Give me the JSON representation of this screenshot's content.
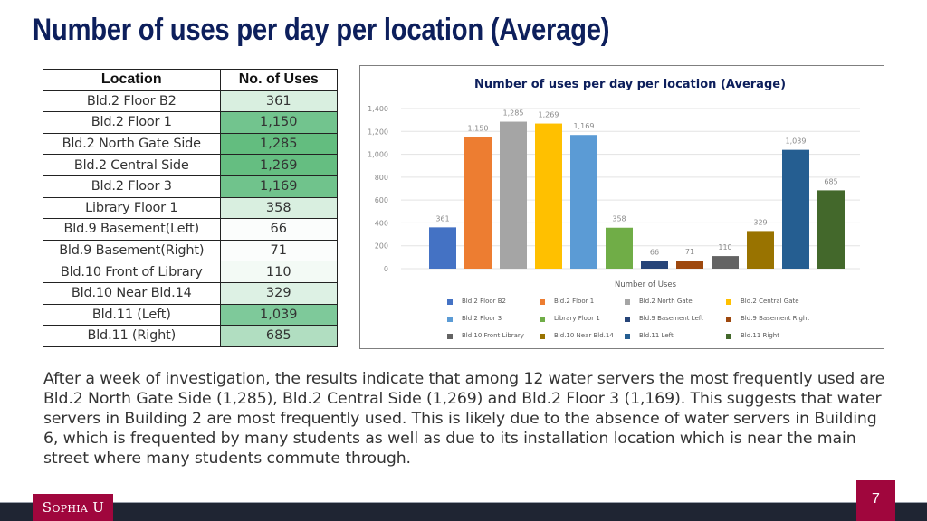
{
  "slide": {
    "title": "Number of uses per day per location (Average)",
    "page_number": "7",
    "logo_text": "Sophia U",
    "body_text": "After a week of investigation, the results indicate that among 12 water servers the most frequently used are Bld.2 North Gate Side (1,285), Bld.2 Central Side (1,269) and Bld.2 Floor 3 (1,169). This suggests that water servers in Building 2 are most frequently used. This is likely due to the absence of water servers in Building 6, which is frequented by many students as well as due to its installation location which is near the main street where many students commute through."
  },
  "table": {
    "headers": [
      "Location",
      "No. of Uses"
    ],
    "rows": [
      {
        "location": "Bld.2 Floor B2",
        "uses": "361",
        "shade": "#d9efe0"
      },
      {
        "location": "Bld.2 Floor 1",
        "uses": "1,150",
        "shade": "#72c48e"
      },
      {
        "location": "Bld.2 North Gate Side",
        "uses": "1,285",
        "shade": "#63bd7f"
      },
      {
        "location": "Bld.2 Central Side",
        "uses": "1,269",
        "shade": "#65be81"
      },
      {
        "location": "Bld.2 Floor 3",
        "uses": "1,169",
        "shade": "#70c38c"
      },
      {
        "location": "Library Floor 1",
        "uses": "358",
        "shade": "#d9efe0"
      },
      {
        "location": "Bld.9 Basement(Left)",
        "uses": "66",
        "shade": "#fbfdfc"
      },
      {
        "location": "Bld.9 Basement(Right)",
        "uses": "71",
        "shade": "#fbfdfc"
      },
      {
        "location": "Bld.10 Front of Library",
        "uses": "110",
        "shade": "#f3faf5"
      },
      {
        "location": "Bld.10 Near Bld.14",
        "uses": "329",
        "shade": "#ddf1e4"
      },
      {
        "location": "Bld.11 (Left)",
        "uses": "1,039",
        "shade": "#7ec99a"
      },
      {
        "location": "Bld.11 (Right)",
        "uses": "685",
        "shade": "#b1deC1"
      }
    ]
  },
  "chart_data": {
    "type": "bar",
    "title": "Number of uses per day per location (Average)",
    "xlabel": "Number of Uses",
    "ylabel": "",
    "ylim": [
      0,
      1400
    ],
    "yticks": [
      0,
      200,
      400,
      600,
      800,
      1000,
      1200,
      1400
    ],
    "ytick_labels": [
      "0",
      "200",
      "400",
      "600",
      "800",
      "1,000",
      "1,200",
      "1,400"
    ],
    "grid": true,
    "legend_position": "bottom",
    "series": [
      {
        "name": "Bld.2 Floor B2",
        "value": 361,
        "label": "361",
        "color": "#4472c4"
      },
      {
        "name": "Bld.2 Floor 1",
        "value": 1150,
        "label": "1,150",
        "color": "#ed7d31"
      },
      {
        "name": "Bld.2 North Gate",
        "value": 1285,
        "label": "1,285",
        "color": "#a5a5a5"
      },
      {
        "name": "Bld.2 Central Gate",
        "value": 1269,
        "label": "1,269",
        "color": "#ffc000"
      },
      {
        "name": "Bld.2 Floor 3",
        "value": 1169,
        "label": "1,169",
        "color": "#5b9bd5"
      },
      {
        "name": "Library Floor 1",
        "value": 358,
        "label": "358",
        "color": "#70ad47"
      },
      {
        "name": "Bld.9 Basement Left",
        "value": 66,
        "label": "66",
        "color": "#264478"
      },
      {
        "name": "Bld.9 Basement Right",
        "value": 71,
        "label": "71",
        "color": "#9e480e"
      },
      {
        "name": "Bld.10 Front Library",
        "value": 110,
        "label": "110",
        "color": "#636363"
      },
      {
        "name": "Bld.10 Near Bld.14",
        "value": 329,
        "label": "329",
        "color": "#997300"
      },
      {
        "name": "Bld.11 Left",
        "value": 1039,
        "label": "1,039",
        "color": "#255e91"
      },
      {
        "name": "Bld.11 Right",
        "value": 685,
        "label": "685",
        "color": "#43682b"
      }
    ]
  }
}
